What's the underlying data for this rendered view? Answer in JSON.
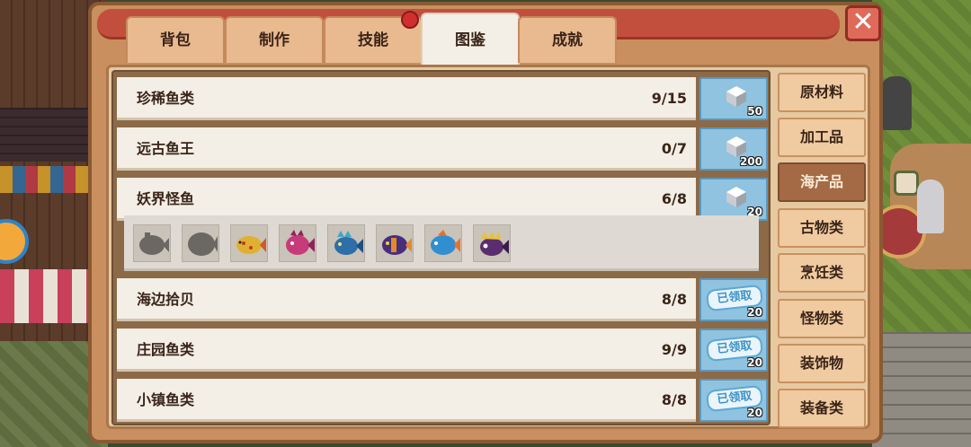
{
  "tabs": [
    {
      "label": "背包"
    },
    {
      "label": "制作"
    },
    {
      "label": "技能"
    },
    {
      "label": "图鉴"
    },
    {
      "label": "成就"
    }
  ],
  "close_label": "✕",
  "rows": [
    {
      "name": "珍稀鱼类",
      "progress": "9/15",
      "reward_count": "50",
      "claimed": false
    },
    {
      "name": "远古鱼王",
      "progress": "0/7",
      "reward_count": "200",
      "claimed": false
    },
    {
      "name": "妖界怪鱼",
      "progress": "6/8",
      "reward_count": "20",
      "claimed": false
    },
    {
      "name": "海边拾贝",
      "progress": "8/8",
      "reward_count": "20",
      "claimed": true,
      "claimed_label": "已领取"
    },
    {
      "name": "庄园鱼类",
      "progress": "9/9",
      "reward_count": "20",
      "claimed": true,
      "claimed_label": "已领取"
    },
    {
      "name": "小镇鱼类",
      "progress": "8/8",
      "reward_count": "20",
      "claimed": true,
      "claimed_label": "已领取"
    }
  ],
  "fish_icons": [
    {
      "name": "fish-silhouette-1-icon",
      "color": "#6b6763",
      "locked": true
    },
    {
      "name": "fish-silhouette-2-icon",
      "color": "#6b6763",
      "locked": true
    },
    {
      "name": "yellow-spotted-fish-icon",
      "color": "#e0b131"
    },
    {
      "name": "pink-monster-fish-icon",
      "color": "#c83b7a"
    },
    {
      "name": "blue-dragon-fish-icon",
      "color": "#2f6fa8"
    },
    {
      "name": "purple-orange-fish-icon",
      "color": "#4a2e7a"
    },
    {
      "name": "blue-orange-fish-icon",
      "color": "#2f8fd0"
    },
    {
      "name": "purple-crowned-fish-icon",
      "color": "#5a2e6e"
    }
  ],
  "categories": [
    {
      "label": "原材料"
    },
    {
      "label": "加工品"
    },
    {
      "label": "海产品",
      "active": true
    },
    {
      "label": "古物类"
    },
    {
      "label": "烹饪类"
    },
    {
      "label": "怪物类"
    },
    {
      "label": "装饰物"
    },
    {
      "label": "装备类"
    }
  ],
  "colors": {
    "panel": "#c98f5e",
    "title_bar": "#c24f3d",
    "reward_bg": "#8fc3e0",
    "active_category": "#a46a45",
    "notification": "#d12f2f"
  }
}
